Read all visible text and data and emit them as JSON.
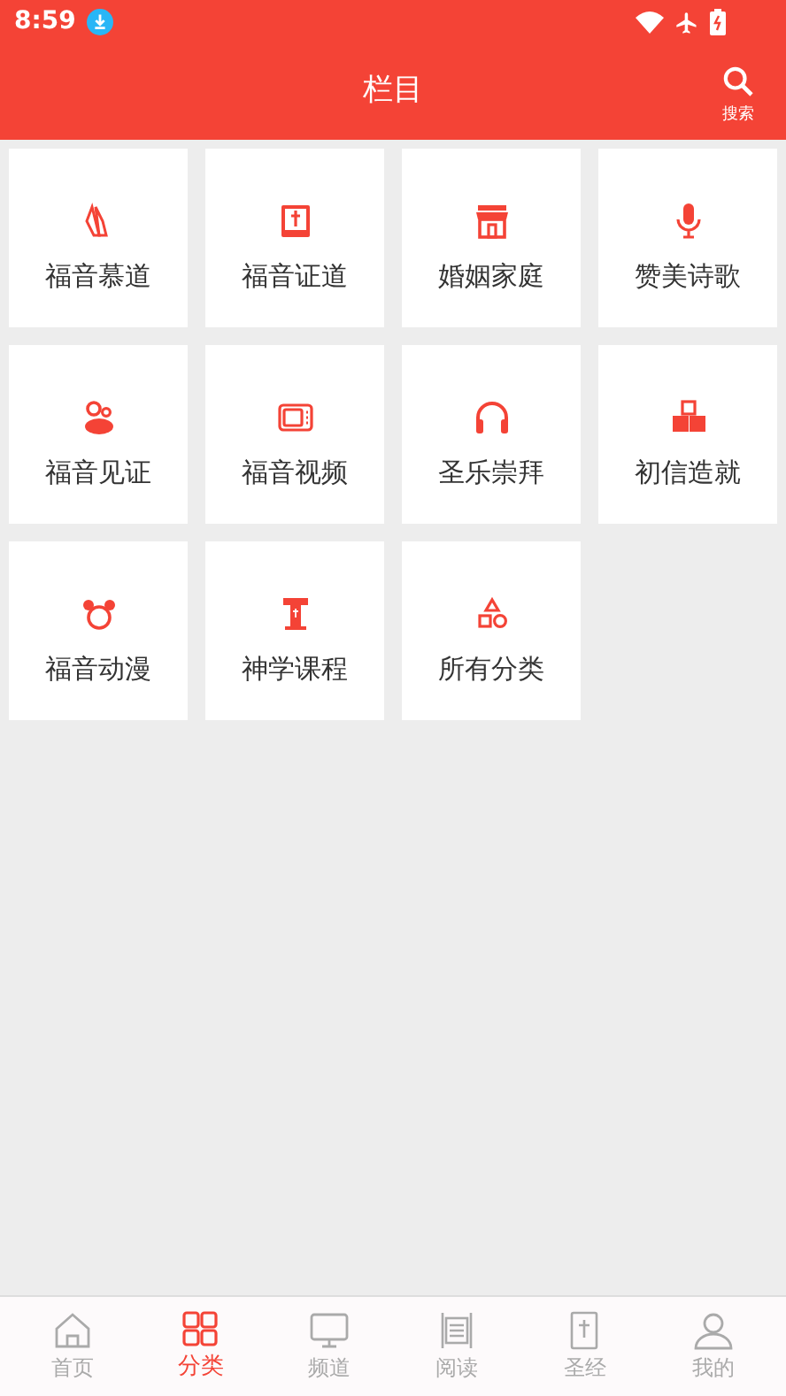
{
  "status_bar": {
    "time": "8:59"
  },
  "header": {
    "title": "栏目",
    "search_label": "搜索"
  },
  "categories": [
    {
      "label": "福音慕道"
    },
    {
      "label": "福音证道"
    },
    {
      "label": "婚姻家庭"
    },
    {
      "label": "赞美诗歌"
    },
    {
      "label": "福音见证"
    },
    {
      "label": "福音视频"
    },
    {
      "label": "圣乐崇拜"
    },
    {
      "label": "初信造就"
    },
    {
      "label": "福音动漫"
    },
    {
      "label": "神学课程"
    },
    {
      "label": "所有分类"
    }
  ],
  "bottom_nav": [
    {
      "label": "首页",
      "selected": false
    },
    {
      "label": "分类",
      "selected": true
    },
    {
      "label": "频道",
      "selected": false
    },
    {
      "label": "阅读",
      "selected": false
    },
    {
      "label": "圣经",
      "selected": false
    },
    {
      "label": "我的",
      "selected": false
    }
  ]
}
